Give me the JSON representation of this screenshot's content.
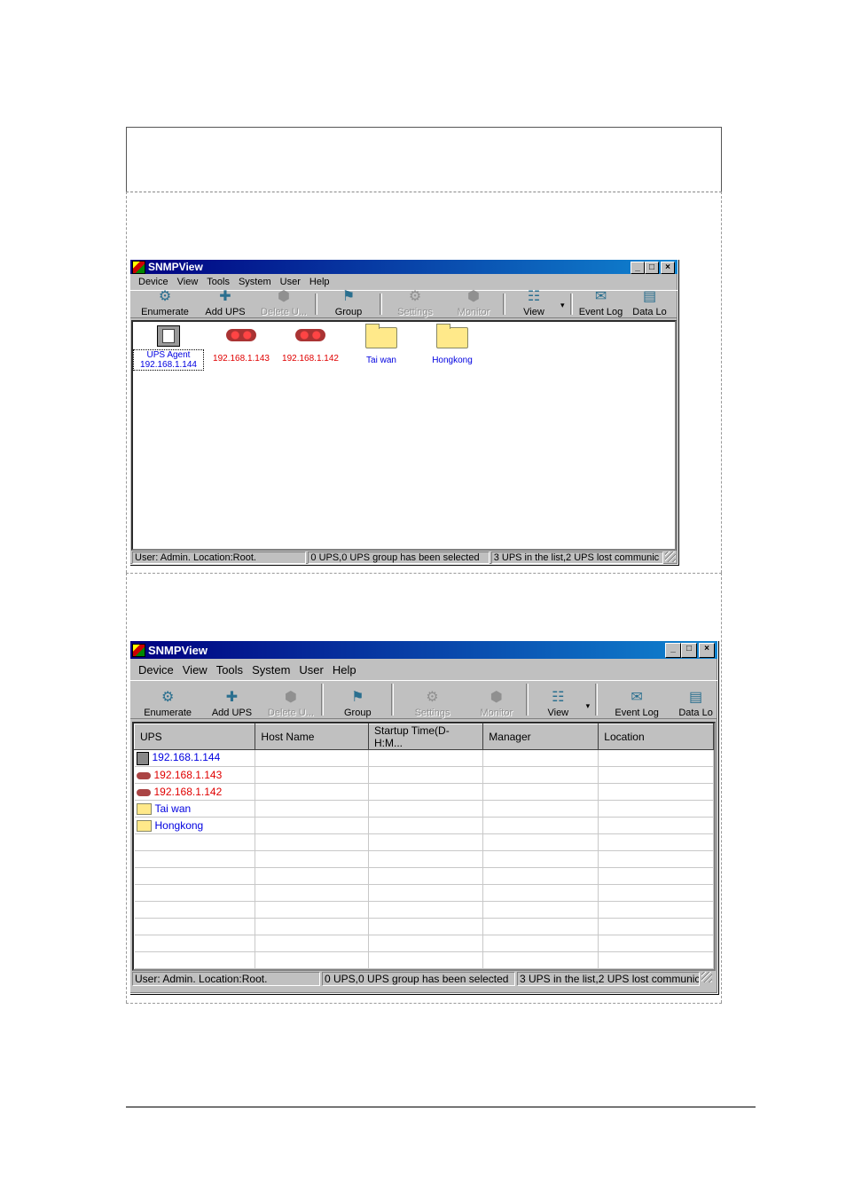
{
  "window1": {
    "title": "SNMPView",
    "menu": [
      "Device",
      "View",
      "Tools",
      "System",
      "User",
      "Help"
    ],
    "toolbar": [
      {
        "label": "Enumerate",
        "icon": "enumerate-icon",
        "enabled": true
      },
      {
        "label": "Add UPS",
        "icon": "add-ups-icon",
        "enabled": true
      },
      {
        "label": "Delete U...",
        "icon": "delete-ups-icon",
        "enabled": false
      },
      {
        "label": "Group",
        "icon": "group-icon",
        "enabled": true
      },
      {
        "label": "Settings",
        "icon": "settings-icon",
        "enabled": false
      },
      {
        "label": "Monitor",
        "icon": "monitor-icon",
        "enabled": false
      },
      {
        "label": "View",
        "icon": "view-icon",
        "enabled": true
      },
      {
        "label": "Event Log",
        "icon": "event-log-icon",
        "enabled": true
      },
      {
        "label": "Data Lo",
        "icon": "data-log-icon",
        "enabled": true
      }
    ],
    "icons": [
      {
        "line1": "UPS Agent",
        "line2": "192.168.1.144"
      },
      {
        "line1": "",
        "line2": "192.168.1.143"
      },
      {
        "line1": "",
        "line2": "192.168.1.142"
      },
      {
        "line1": "Tai wan",
        "line2": ""
      },
      {
        "line1": "Hongkong",
        "line2": ""
      }
    ],
    "status": [
      "User: Admin.  Location:Root.",
      "0 UPS,0 UPS group has been selected",
      "3 UPS  in the list,2 UPS  lost communic"
    ]
  },
  "window2": {
    "title": "SNMPView",
    "menu": [
      "Device",
      "View",
      "Tools",
      "System",
      "User",
      "Help"
    ],
    "toolbar": [
      {
        "label": "Enumerate"
      },
      {
        "label": "Add UPS"
      },
      {
        "label": "Delete U..."
      },
      {
        "label": "Group"
      },
      {
        "label": "Settings"
      },
      {
        "label": "Monitor"
      },
      {
        "label": "View"
      },
      {
        "label": "Event Log"
      },
      {
        "label": "Data Lo"
      }
    ],
    "columns": [
      "UPS",
      "Host Name",
      "Startup Time(D-H:M...",
      "Manager",
      "Location"
    ],
    "rows": [
      {
        "name": "192.168.1.144",
        "kind": "agent",
        "color": "blue"
      },
      {
        "name": "192.168.1.143",
        "kind": "ups",
        "color": "red"
      },
      {
        "name": "192.168.1.142",
        "kind": "ups",
        "color": "red"
      },
      {
        "name": "Tai wan",
        "kind": "folder",
        "color": "blue"
      },
      {
        "name": "Hongkong",
        "kind": "folder",
        "color": "blue"
      }
    ],
    "status": [
      "User: Admin.  Location:Root.",
      "0 UPS,0 UPS group has been selected",
      "3 UPS  in the list,2 UPS  lost communic"
    ]
  },
  "colors": {
    "blue": "#0000e0",
    "red": "#e00000",
    "titlebar": "#000080"
  }
}
